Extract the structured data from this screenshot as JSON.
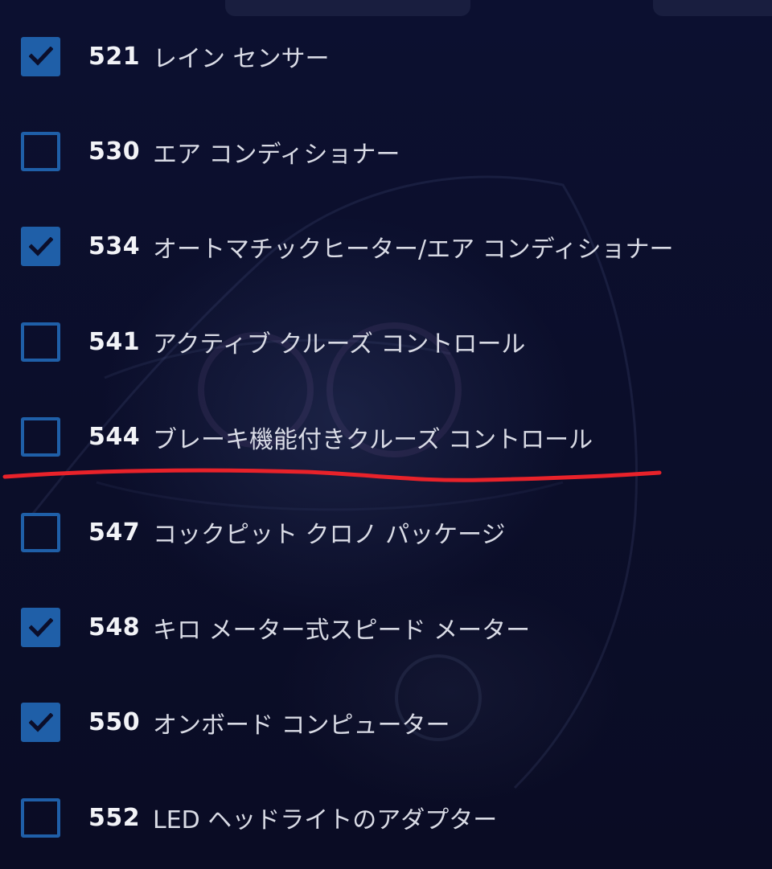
{
  "options": [
    {
      "code": "521",
      "label": "レイン センサー",
      "checked": true
    },
    {
      "code": "530",
      "label": "エア コンディショナー",
      "checked": false
    },
    {
      "code": "534",
      "label": "オートマチックヒーター/エア コンディショナー",
      "checked": true
    },
    {
      "code": "541",
      "label": "アクティブ クルーズ コントロール",
      "checked": false
    },
    {
      "code": "544",
      "label": "ブレーキ機能付きクルーズ コントロール",
      "checked": false
    },
    {
      "code": "547",
      "label": "コックピット クロノ パッケージ",
      "checked": false
    },
    {
      "code": "548",
      "label": "キロ メーター式スピード メーター",
      "checked": true
    },
    {
      "code": "550",
      "label": "オンボード コンピューター",
      "checked": true
    },
    {
      "code": "552",
      "label": "LED ヘッドライトのアダプター",
      "checked": false
    }
  ],
  "colors": {
    "background": "#0b0e2a",
    "checkbox": "#1f5fa8",
    "code_text": "#f2f3f7",
    "label_text": "#d9dbe5",
    "annotation_line": "#e8222a"
  },
  "icons": {
    "checked": "checkmark-icon",
    "annotation": "red-underline-stroke"
  }
}
